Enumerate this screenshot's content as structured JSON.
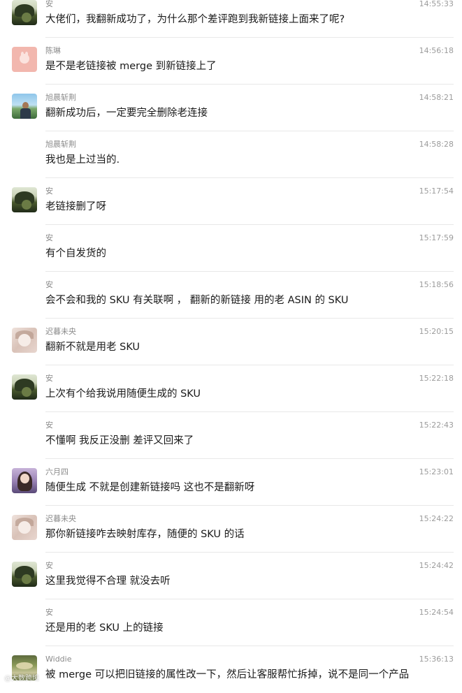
{
  "messages": [
    {
      "sender": "安",
      "time": "14:55:33",
      "text": "大佬们，我翻新成功了，为什么那个差评跑到我新链接上面来了呢?",
      "avatar": "an",
      "show_avatar": true
    },
    {
      "sender": "陈琳",
      "time": "14:56:18",
      "text": "是不是老链接被 merge 到新链接上了",
      "avatar": "chen",
      "show_avatar": true
    },
    {
      "sender": "旭晨斩荆",
      "time": "14:58:21",
      "text": "翻新成功后，一定要完全删除老连接",
      "avatar": "xu",
      "show_avatar": true
    },
    {
      "sender": "旭晨斩荆",
      "time": "14:58:28",
      "text": "我也是上过当的.",
      "avatar": "xu",
      "show_avatar": false
    },
    {
      "sender": "安",
      "time": "15:17:54",
      "text": "老链接删了呀",
      "avatar": "an",
      "show_avatar": true
    },
    {
      "sender": "安",
      "time": "15:17:59",
      "text": "有个自发货的",
      "avatar": "an",
      "show_avatar": false
    },
    {
      "sender": "安",
      "time": "15:18:56",
      "text": "会不会和我的 SKU 有关联啊 ， 翻新的新链接 用的老 ASIN 的 SKU",
      "avatar": "an",
      "show_avatar": false
    },
    {
      "sender": "迟暮未央",
      "time": "15:20:15",
      "text": "翻新不就是用老 SKU",
      "avatar": "chi",
      "show_avatar": true
    },
    {
      "sender": "安",
      "time": "15:22:18",
      "text": "上次有个给我说用随便生成的 SKU",
      "avatar": "an",
      "show_avatar": true
    },
    {
      "sender": "安",
      "time": "15:22:43",
      "text": "不懂啊  我反正没删 差评又回来了",
      "avatar": "an",
      "show_avatar": false
    },
    {
      "sender": "六月四",
      "time": "15:23:01",
      "text": "随便生成 不就是创建新链接吗 这也不是翻新呀",
      "avatar": "liu",
      "show_avatar": true
    },
    {
      "sender": "迟暮未央",
      "time": "15:24:22",
      "text": "那你新链接咋去映射库存，随便的 SKU 的话",
      "avatar": "chi",
      "show_avatar": true
    },
    {
      "sender": "安",
      "time": "15:24:42",
      "text": "这里我觉得不合理  就没去听",
      "avatar": "an",
      "show_avatar": true
    },
    {
      "sender": "安",
      "time": "15:24:54",
      "text": "还是用的老 SKU 上的链接",
      "avatar": "an",
      "show_avatar": false
    },
    {
      "sender": "Widdie",
      "time": "15:36:13",
      "text": "被 merge 可以把旧链接的属性改一下，然后让客服帮忙拆掉，说不是同一个产品",
      "avatar": "wid",
      "show_avatar": true
    }
  ],
  "watermark": "@大数跨境"
}
